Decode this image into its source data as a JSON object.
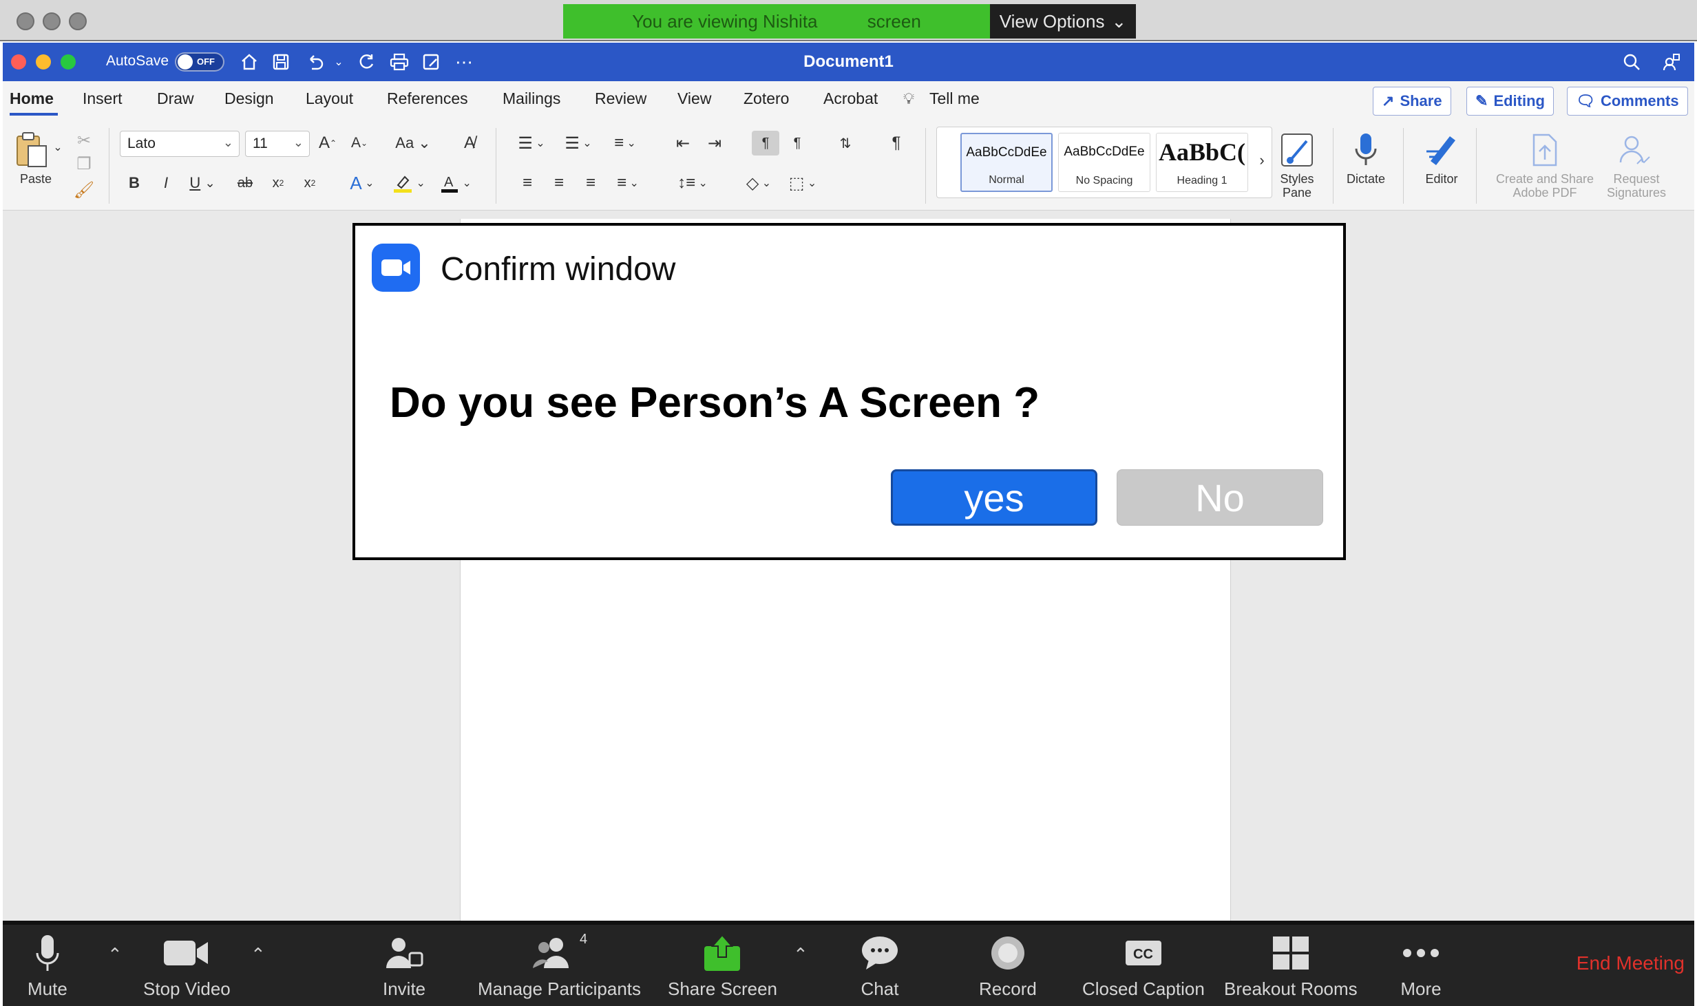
{
  "zoom_top": {
    "banner_text": "You are viewing Nishita          screen",
    "view_options_label": "View Options",
    "view_options_icon": "chevron-down-icon"
  },
  "word": {
    "autosave_label": "AutoSave",
    "autosave_state": "OFF",
    "document_title": "Document1",
    "tabs": [
      "Home",
      "Insert",
      "Draw",
      "Design",
      "Layout",
      "References",
      "Mailings",
      "Review",
      "View",
      "Zotero",
      "Acrobat"
    ],
    "tell_me": "Tell me",
    "share_label": "Share",
    "editing_label": "Editing",
    "comments_label": "Comments",
    "paste_label": "Paste",
    "font_name": "Lato",
    "font_size": "11",
    "styles": [
      {
        "sample": "AaBbCcDdEe",
        "name": "Normal"
      },
      {
        "sample": "AaBbCcDdEe",
        "name": "No Spacing"
      },
      {
        "sample": "AaBbC(",
        "name": "Heading 1"
      }
    ],
    "styles_pane_label": "Styles Pane",
    "dictate_label": "Dictate",
    "editor_label": "Editor",
    "adobe_label": "Create and Share Adobe PDF",
    "signatures_label": "Request Signatures"
  },
  "dialog": {
    "title": "Confirm window",
    "question": "Do you see Person’s A Screen ?",
    "yes_label": "yes",
    "no_label": "No"
  },
  "zoom_toolbar": {
    "items": [
      "Mute",
      "Stop Video",
      "Invite",
      "Manage Participants",
      "Share Screen",
      "Chat",
      "Record",
      "Closed Caption",
      "Breakout Rooms",
      "More"
    ],
    "participants_count": "4",
    "end_label": "End Meeting",
    "colors": {
      "share_green": "#3fbf2c",
      "end_red": "#e0312b"
    }
  }
}
